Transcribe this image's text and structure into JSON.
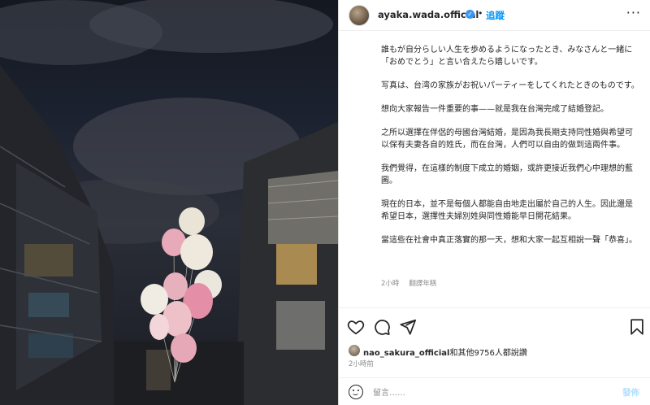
{
  "header": {
    "username": "ayaka.wada.official",
    "separator": "•",
    "follow_label": "追蹤",
    "more_label": "···"
  },
  "caption": {
    "paragraphs": [
      "誰もが自分らしい人生を歩めるようになったとき、みなさんと一緒に「おめでとう」と言い合えたら嬉しいです。",
      "写真は、台湾の家族がお祝いパーティーをしてくれたときのものです。",
      "想向大家報告一件重要的事——就是我在台灣完成了結婚登記。",
      "之所以選擇在伴侶的母國台灣結婚，是因為我長期支持同性婚與希望可以保有夫妻各自的姓氏，而在台灣，人們可以自由的做到這兩件事。",
      "我們覺得，在這樣的制度下成立的婚姻，或許更接近我們心中理想的藍圖。",
      "現在的日本，並不是每個人都能自由地走出屬於自己的人生。因此還是希望日本，選擇性夫婦別姓與同性婚能早日開花結果。",
      "當這些在社會中真正落實的那一天，想和大家一起互相說一聲「恭喜」。"
    ]
  },
  "meta": {
    "time_ago": "2小時",
    "translate_label": "翻譯年糕"
  },
  "likes": {
    "user": "nao_sakura_official",
    "rest": "和其他9756人都說讚"
  },
  "post_time": "2小時前",
  "comment": {
    "placeholder": "留言……",
    "post_label": "發佈"
  },
  "icons": {
    "like": "heart-icon",
    "comment": "comment-icon",
    "share": "share-icon",
    "save": "bookmark-icon",
    "emoji": "emoji-icon",
    "verified": "verified-badge-icon"
  },
  "colors": {
    "follow_blue": "#0095f6",
    "verified_blue": "#3897f0",
    "post_disabled": "#b2dffc",
    "muted_text": "#8e8e8e"
  }
}
